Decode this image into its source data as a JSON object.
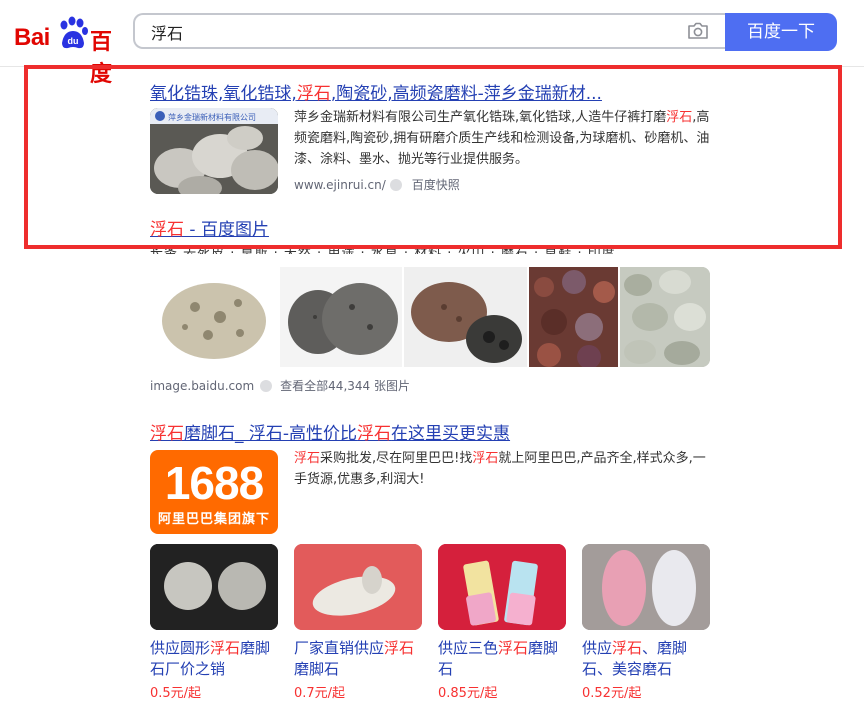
{
  "header": {
    "logo_text_left": "Bai",
    "logo_text_right": "百度",
    "search_value": "浮石",
    "search_button": "百度一下",
    "camera_icon": "camera-icon"
  },
  "result1": {
    "title_parts": [
      "氧化锆珠,氧化锆球,",
      "浮石",
      ",陶瓷砂,高频瓷磨料-萍乡金瑞新材..."
    ],
    "thumb_caption": "萍乡金瑞新材料有限公司",
    "desc_parts": [
      "萍乡金瑞新材料有限公司生产氧化锆珠,氧化锆球,人造牛仔裤打磨",
      "浮石",
      ",高频瓷磨料,陶瓷砂,拥有研磨介质生产线和检测设备,为球磨机、砂磨机、油漆、涂料、墨水、抛光等行业提供服务。"
    ],
    "url": "www.ejinrui.cn/",
    "snapshot": "百度快照"
  },
  "result2": {
    "title_highlight": "浮石",
    "title_rest": " - 百度图片",
    "tags": "长条 去死皮 · 莫斯 · 天然 · 用途 · 水草 · 材料 · 火山 · 磨石 · 草鞋 · 印度",
    "source": "image.baidu.com",
    "view_all": "查看全部44,344 张图片"
  },
  "result3": {
    "title_parts": [
      "浮石",
      "磨脚石_ 浮石-高性价比",
      "浮石",
      "在这里买更实惠"
    ],
    "logo_number": "1688",
    "logo_sub": "阿里巴巴集团旗下",
    "desc_parts": [
      "浮石",
      "采购批发,尽在阿里巴巴!找",
      "浮石",
      "就上阿里巴巴,产品齐全,样式众多,一手货源,优惠多,利润大!"
    ],
    "products": [
      {
        "label_parts": [
          "供应圆形",
          "浮石",
          "磨脚石厂价之销"
        ],
        "price": "0.5元/起"
      },
      {
        "label_parts": [
          "厂家直销供应",
          "浮石",
          "磨脚石"
        ],
        "price": "0.7元/起"
      },
      {
        "label_parts": [
          "供应三色",
          "浮石",
          "磨脚石"
        ],
        "price": "0.85元/起"
      },
      {
        "label_parts": [
          "供应",
          "浮石",
          "、磨脚石、美容磨石"
        ],
        "price": "0.52元/起"
      }
    ]
  },
  "colors": {
    "brand_blue": "#4e6ef2",
    "link_blue": "#2440b3",
    "highlight_red": "#f73131",
    "annotation_border": "#ee2d2d",
    "alibaba_orange": "#ff6a00"
  }
}
